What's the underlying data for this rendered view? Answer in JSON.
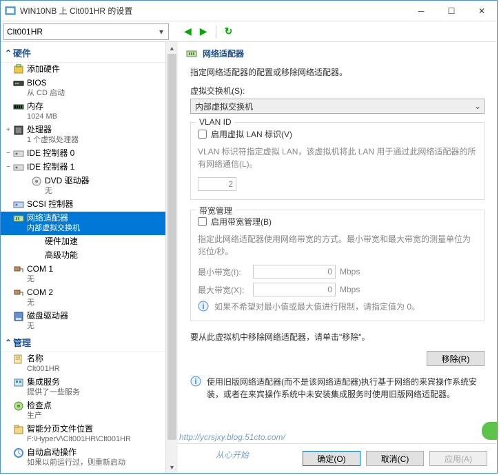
{
  "window": {
    "title": "WIN10NB 上 Clt001HR 的设置"
  },
  "toolbar": {
    "combo": "Clt001HR"
  },
  "tree": {
    "hardware_hdr": "硬件",
    "items": [
      {
        "label": "添加硬件",
        "sub": ""
      },
      {
        "label": "BIOS",
        "sub": "从 CD 启动"
      },
      {
        "label": "内存",
        "sub": "1024 MB"
      },
      {
        "label": "处理器",
        "sub": "1 个虚拟处理器",
        "exp": "+"
      },
      {
        "label": "IDE 控制器 0",
        "sub": "",
        "exp": "−"
      },
      {
        "label": "IDE 控制器 1",
        "sub": "",
        "exp": "−"
      },
      {
        "label": "DVD 驱动器",
        "sub": "无",
        "child": true
      },
      {
        "label": "SCSI 控制器",
        "sub": ""
      },
      {
        "label": "网络适配器",
        "sub": "内部虚拟交换机",
        "sel": true,
        "exp": "−"
      },
      {
        "label": "硬件加速",
        "sub": "",
        "child": true
      },
      {
        "label": "高级功能",
        "sub": "",
        "child": true
      },
      {
        "label": "COM 1",
        "sub": "无"
      },
      {
        "label": "COM 2",
        "sub": "无"
      },
      {
        "label": "磁盘驱动器",
        "sub": "无"
      }
    ],
    "mgmt_hdr": "管理",
    "mgmt": [
      {
        "label": "名称",
        "sub": "Clt001HR"
      },
      {
        "label": "集成服务",
        "sub": "提供了一些服务"
      },
      {
        "label": "检查点",
        "sub": "生产"
      },
      {
        "label": "智能分页文件位置",
        "sub": "F:\\HyperV\\Clt001HR\\Clt001HR"
      },
      {
        "label": "自动启动操作",
        "sub": "如果以前运行过，则重新启动"
      }
    ]
  },
  "panel": {
    "title": "网络适配器",
    "desc": "指定网络适配器的配置或移除网络适配器。",
    "switch_label": "虚拟交换机(S):",
    "switch_value": "内部虚拟交换机",
    "vlan_title": "VLAN ID",
    "vlan_enable": "启用虚拟 LAN 标识(V)",
    "vlan_help": "VLAN 标识符指定虚拟 LAN，该虚拟机将此 LAN 用于通过此网络适配器的所有网络通信(L)。",
    "vlan_value": "2",
    "bw_title": "带宽管理",
    "bw_enable": "启用带宽管理(B)",
    "bw_help": "指定此网络适配器使用网络带宽的方式。最小带宽和最大带宽的测量单位为兆位/秒。",
    "bw_min_label": "最小带宽(I):",
    "bw_min_value": "0",
    "bw_max_label": "最大带宽(X):",
    "bw_max_value": "0",
    "bw_unit": "Mbps",
    "bw_info": "如果不希望对最小值或最大值进行限制，请指定值为 0。",
    "remove_desc": "要从此虚拟机中移除网络适配器，请单击\"移除\"。",
    "remove_btn": "移除(R)",
    "legacy_warn": "使用旧版网络适配器(而不是该网络适配器)执行基于网络的来宾操作系统安装，或者在来宾操作系统中未安装集成服务时使用旧版网络适配器。"
  },
  "footer": {
    "ok": "确定(O)",
    "cancel": "取消(C)",
    "apply": "应用(A)"
  },
  "watermark": {
    "url": "http://ycrsjxy.blog.51cto.com/",
    "sub": "从心开始"
  }
}
